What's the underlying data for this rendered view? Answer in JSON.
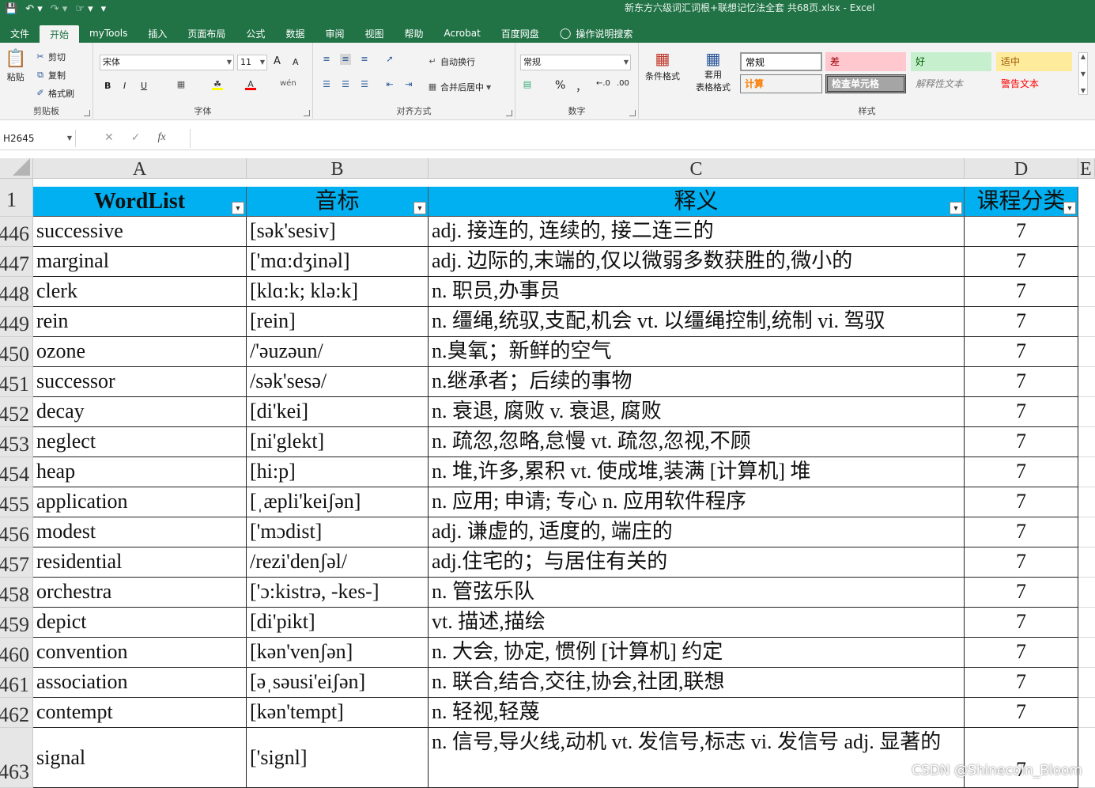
{
  "window": {
    "title": "新东方六级词汇词根+联想记忆法全套 共68页.xlsx  -  Excel"
  },
  "qat": {
    "save_icon": "save-icon",
    "undo_icon": "undo-icon",
    "redo_icon": "redo-icon",
    "touch_icon": "touch-mode-icon",
    "more_icon": "customize-icon"
  },
  "tabs": [
    "文件",
    "开始",
    "myTools",
    "插入",
    "页面布局",
    "公式",
    "数据",
    "审阅",
    "视图",
    "帮助",
    "Acrobat",
    "百度网盘",
    "操作说明搜索"
  ],
  "ribbon": {
    "clipboard": {
      "paste": "粘贴",
      "cut": "剪切",
      "copy": "复制",
      "format_painter": "格式刷",
      "label": "剪贴板"
    },
    "font": {
      "name": "宋体",
      "size": "11",
      "label": "字体",
      "bold": "B",
      "italic": "I",
      "underline": "U",
      "grow": "A",
      "shrink": "A",
      "wen": "wén"
    },
    "alignment": {
      "wrap": "自动换行",
      "merge": "合并后居中",
      "label": "对齐方式"
    },
    "number": {
      "format": "常规",
      "percent": "%",
      "comma": "，",
      "label": "数字"
    },
    "styles": {
      "conditional": "条件格式",
      "table": "套用",
      "table2": "表格格式",
      "normal": "常规",
      "bad": "差",
      "good": "好",
      "neutral": "适中",
      "calc": "计算",
      "check": "检查单元格",
      "explanatory": "解释性文本",
      "warning": "警告文本",
      "label": "样式"
    }
  },
  "formula_bar": {
    "name_box": "H2645",
    "cancel": "✕",
    "enter": "✓",
    "fx": "fx",
    "value": ""
  },
  "columns": [
    "A",
    "B",
    "C",
    "D",
    "E"
  ],
  "header_row": {
    "row_num": "1",
    "cells": [
      "WordList",
      "音标",
      "释义",
      "课程分类"
    ]
  },
  "rows": [
    {
      "num": "446",
      "word": "successive",
      "phonetic": "[sək'sesiv]",
      "meaning": "adj. 接连的, 连续的, 接二连三的",
      "course": "7"
    },
    {
      "num": "447",
      "word": "marginal",
      "phonetic": "['mɑ:dʒinəl]",
      "meaning": "adj. 边际的,末端的,仅以微弱多数获胜的,微小的",
      "course": "7"
    },
    {
      "num": "448",
      "word": "clerk",
      "phonetic": "[klɑ:k; klə:k]",
      "meaning": "n. 职员,办事员",
      "course": "7"
    },
    {
      "num": "449",
      "word": "rein",
      "phonetic": "[rein]",
      "meaning": "n. 缰绳,统驭,支配,机会 vt. 以缰绳控制,统制 vi. 驾驭",
      "course": "7"
    },
    {
      "num": "450",
      "word": "ozone",
      "phonetic": "/'əuzəun/",
      "meaning": "n.臭氧；新鲜的空气",
      "course": "7"
    },
    {
      "num": "451",
      "word": "successor",
      "phonetic": "/sək'sesə/",
      "meaning": "n.继承者；后续的事物",
      "course": "7"
    },
    {
      "num": "452",
      "word": "decay",
      "phonetic": "[di'kei]",
      "meaning": "n. 衰退, 腐败 v. 衰退, 腐败",
      "course": "7"
    },
    {
      "num": "453",
      "word": "neglect",
      "phonetic": "[ni'glekt]",
      "meaning": "n. 疏忽,忽略,怠慢 vt. 疏忽,忽视,不顾",
      "course": "7"
    },
    {
      "num": "454",
      "word": "heap",
      "phonetic": "[hi:p]",
      "meaning": "n. 堆,许多,累积 vt. 使成堆,装满 [计算机] 堆",
      "course": "7"
    },
    {
      "num": "455",
      "word": "application",
      "phonetic": "[ˌæpli'keiʃən]",
      "meaning": "n. 应用; 申请; 专心 n. 应用软件程序",
      "course": "7"
    },
    {
      "num": "456",
      "word": "modest",
      "phonetic": "['mɔdist]",
      "meaning": "adj. 谦虚的, 适度的, 端庄的",
      "course": "7"
    },
    {
      "num": "457",
      "word": "residential",
      "phonetic": "/rezi'denʃəl/",
      "meaning": "adj.住宅的；与居住有关的",
      "course": "7"
    },
    {
      "num": "458",
      "word": "orchestra",
      "phonetic": "['ɔ:kistrə, -kes-]",
      "meaning": "n. 管弦乐队",
      "course": "7"
    },
    {
      "num": "459",
      "word": "depict",
      "phonetic": "[di'pikt]",
      "meaning": "vt. 描述,描绘",
      "course": "7"
    },
    {
      "num": "460",
      "word": "convention",
      "phonetic": "[kən'venʃən]",
      "meaning": "n. 大会, 协定, 惯例 [计算机] 约定",
      "course": "7"
    },
    {
      "num": "461",
      "word": "association",
      "phonetic": "[əˌsəusi'eiʃən]",
      "meaning": "n. 联合,结合,交往,协会,社团,联想",
      "course": "7"
    },
    {
      "num": "462",
      "word": "contempt",
      "phonetic": "[kən'tempt]",
      "meaning": "n. 轻视,轻蔑",
      "course": "7"
    },
    {
      "num": "463",
      "word": "signal",
      "phonetic": "['signl]",
      "meaning": "n. 信号,导火线,动机 vt. 发信号,标志 vi. 发信号 adj. 显著的",
      "course": "7"
    }
  ],
  "watermark": "CSDN @Shinecoln_Bloom"
}
